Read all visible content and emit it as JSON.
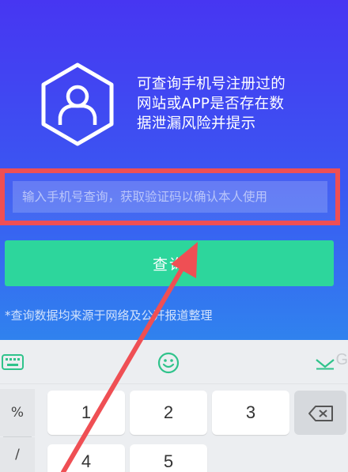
{
  "headline": {
    "line1": "可查询手机号注册过的",
    "line2": "网站或APP是否存在数",
    "line3": "据泄漏风险并提示"
  },
  "phone_input": {
    "placeholder": "输入手机号查询，获取验证码以确认本人使用",
    "value": ""
  },
  "query_button": {
    "label": "查询"
  },
  "note": "*查询数据均来源于网络及公开报道整理",
  "keyboard": {
    "toolbar": [
      {
        "icon": "keyboard-icon"
      },
      {
        "icon": "emoji-icon"
      },
      {
        "icon": "collapse-keyboard-icon"
      }
    ],
    "side_keys": [
      "%",
      "/"
    ],
    "keys": [
      "1",
      "2",
      "3",
      "4",
      "5"
    ],
    "delete_icon": "backspace-icon"
  },
  "colors": {
    "bg_top": "#4736f2",
    "bg_bottom": "#34a3ee",
    "button": "#2dd69c",
    "highlight": "#ef4f54",
    "keyboard_accent": "#2fc38b"
  }
}
